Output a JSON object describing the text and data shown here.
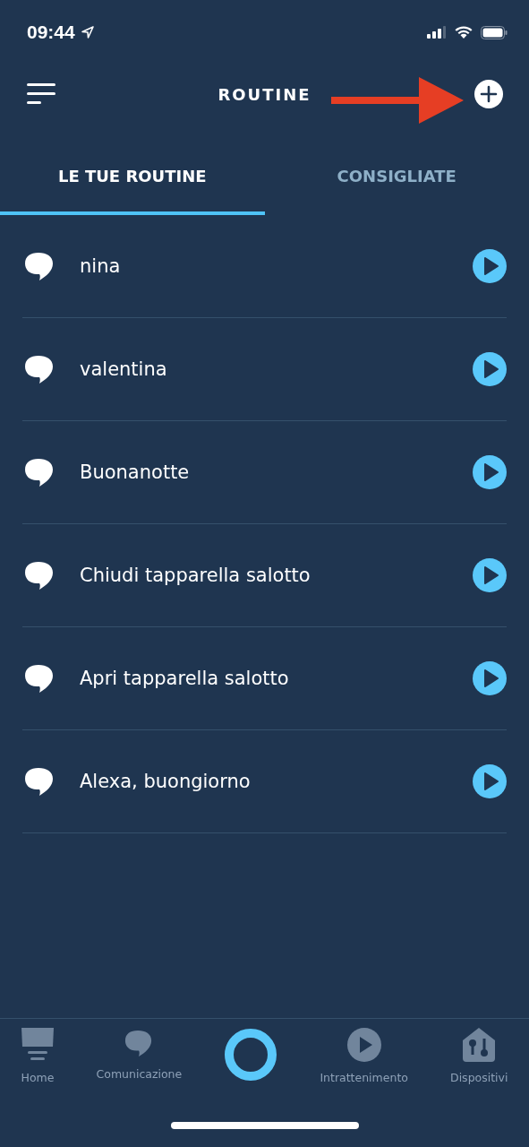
{
  "status_bar": {
    "time": "09:44"
  },
  "header": {
    "title": "ROUTINE"
  },
  "tabs": [
    {
      "label": "LE TUE ROUTINE",
      "selected": true
    },
    {
      "label": "CONSIGLIATE",
      "selected": false
    }
  ],
  "routines": [
    {
      "name": "nina"
    },
    {
      "name": "valentina"
    },
    {
      "name": "Buonanotte"
    },
    {
      "name": "Chiudi tapparella salotto"
    },
    {
      "name": "Apri tapparella salotto"
    },
    {
      "name": "Alexa, buongiorno"
    }
  ],
  "bottom_nav": [
    {
      "kind": "home",
      "label": "Home"
    },
    {
      "kind": "chat",
      "label": "Comunicazione"
    },
    {
      "kind": "alexa"
    },
    {
      "kind": "play",
      "label": "Intrattenimento"
    },
    {
      "kind": "devices",
      "label": "Dispositivi"
    }
  ]
}
